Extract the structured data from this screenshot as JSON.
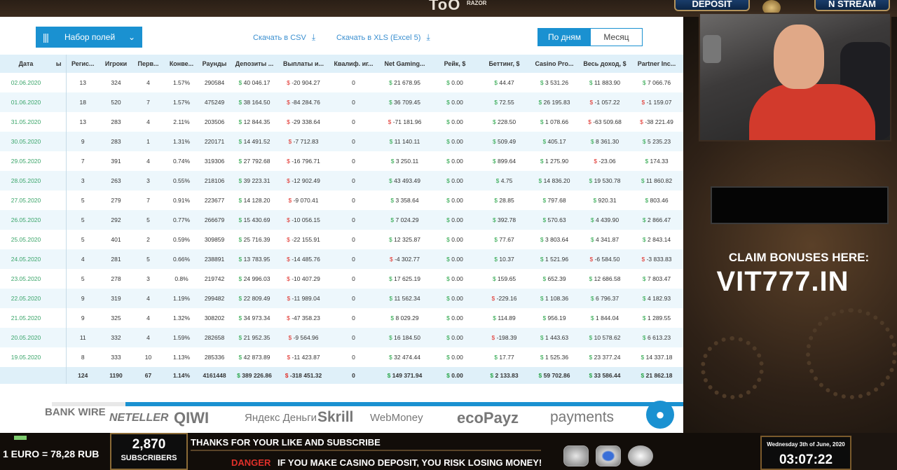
{
  "stream": {
    "logo": "ToO",
    "logo_sub": "RAZOR",
    "deposit_label": "DEPOSIT",
    "stream_label": "N STREAM",
    "claim_text": "CLAIM BONUSES HERE:",
    "claim_url": "VIT777.IN",
    "date_text": "Wednesday 3th of June, 2020",
    "time_text": "03:07:22",
    "euro_rate": "1 EURO = 78,28 RUB",
    "subscribers_count": "2,870",
    "subscribers_label": "SUBSCRIBERS",
    "ticker_top": "THANKS FOR YOUR LIKE AND SUBSCRIBE",
    "danger_label": "DANGER",
    "ticker_bottom": "IF YOU MAKE CASINO DEPOSIT, YOU RISK LOSING MONEY!"
  },
  "toolbar": {
    "fields_label": "Набор полей",
    "csv_label": "Скачать в CSV",
    "xls_label": "Скачать в XLS (Excel 5)",
    "by_days": "По дням",
    "month": "Месяц"
  },
  "table": {
    "headers": [
      "Дата",
      "ы",
      "Регис...",
      "Игроки",
      "Перв...",
      "Конве...",
      "Раунды",
      "Депозиты ...",
      "Выплаты и...",
      "Квалиф. иг...",
      "Net Gaming...",
      "Рейк, $",
      "Беттинг, $",
      "Casino Pro...",
      "Весь доход, $",
      "Partner Inc..."
    ],
    "rows": [
      [
        "02.06.2020",
        "",
        "13",
        "324",
        "4",
        "1.57%",
        "290584",
        "40 046.17",
        "-20 904.27",
        "0",
        "21 678.95",
        "0.00",
        "44.47",
        "3 531.26",
        "11 883.90",
        "7 066.76"
      ],
      [
        "01.06.2020",
        "",
        "18",
        "520",
        "7",
        "1.57%",
        "475249",
        "38 164.50",
        "-84 284.76",
        "0",
        "36 709.45",
        "0.00",
        "72.55",
        "26 195.83",
        "-1 057.22",
        "-1 159.07"
      ],
      [
        "31.05.2020",
        "",
        "13",
        "283",
        "4",
        "2.11%",
        "203506",
        "12 844.35",
        "-29 338.64",
        "0",
        "-71 181.96",
        "0.00",
        "228.50",
        "1 078.66",
        "-63 509.68",
        "-38 221.49"
      ],
      [
        "30.05.2020",
        "",
        "9",
        "283",
        "1",
        "1.31%",
        "220171",
        "14 491.52",
        "-7 712.83",
        "0",
        "11 140.11",
        "0.00",
        "509.49",
        "405.17",
        "8 361.30",
        "5 235.23"
      ],
      [
        "29.05.2020",
        "",
        "7",
        "391",
        "4",
        "0.74%",
        "319306",
        "27 792.68",
        "-16 796.71",
        "0",
        "3 250.11",
        "0.00",
        "899.64",
        "1 275.90",
        "-23.06",
        "174.33"
      ],
      [
        "28.05.2020",
        "",
        "3",
        "263",
        "3",
        "0.55%",
        "218106",
        "39 223.31",
        "-12 902.49",
        "0",
        "43 493.49",
        "0.00",
        "4.75",
        "14 836.20",
        "19 530.78",
        "11 860.82"
      ],
      [
        "27.05.2020",
        "",
        "5",
        "279",
        "7",
        "0.91%",
        "223677",
        "14 128.20",
        "-9 070.41",
        "0",
        "3 358.64",
        "0.00",
        "28.85",
        "797.68",
        "920.31",
        "803.46"
      ],
      [
        "26.05.2020",
        "",
        "5",
        "292",
        "5",
        "0.77%",
        "266679",
        "15 430.69",
        "-10 056.15",
        "0",
        "7 024.29",
        "0.00",
        "392.78",
        "570.63",
        "4 439.90",
        "2 866.47"
      ],
      [
        "25.05.2020",
        "",
        "5",
        "401",
        "2",
        "0.59%",
        "309859",
        "25 716.39",
        "-22 155.91",
        "0",
        "12 325.87",
        "0.00",
        "77.67",
        "3 803.64",
        "4 341.87",
        "2 843.14"
      ],
      [
        "24.05.2020",
        "",
        "4",
        "281",
        "5",
        "0.66%",
        "238891",
        "13 783.95",
        "-14 485.76",
        "0",
        "-4 302.77",
        "0.00",
        "10.37",
        "1 521.96",
        "-6 584.50",
        "-3 833.83"
      ],
      [
        "23.05.2020",
        "",
        "5",
        "278",
        "3",
        "0.8%",
        "219742",
        "24 996.03",
        "-10 407.29",
        "0",
        "17 625.19",
        "0.00",
        "159.65",
        "652.39",
        "12 686.58",
        "7 803.47"
      ],
      [
        "22.05.2020",
        "",
        "9",
        "319",
        "4",
        "1.19%",
        "299482",
        "22 809.49",
        "-11 989.04",
        "0",
        "11 562.34",
        "0.00",
        "-229.16",
        "1 108.36",
        "6 796.37",
        "4 182.93"
      ],
      [
        "21.05.2020",
        "",
        "9",
        "325",
        "4",
        "1.32%",
        "308202",
        "34 973.34",
        "-47 358.23",
        "0",
        "8 029.29",
        "0.00",
        "114.89",
        "956.19",
        "1 844.04",
        "1 289.55"
      ],
      [
        "20.05.2020",
        "",
        "11",
        "332",
        "4",
        "1.59%",
        "282658",
        "21 952.35",
        "-9 564.96",
        "0",
        "16 184.50",
        "0.00",
        "-198.39",
        "1 443.63",
        "10 578.62",
        "6 613.23"
      ],
      [
        "19.05.2020",
        "",
        "8",
        "333",
        "10",
        "1.13%",
        "285336",
        "42 873.89",
        "-11 423.87",
        "0",
        "32 474.44",
        "0.00",
        "17.77",
        "1 525.36",
        "23 377.24",
        "14 337.18"
      ]
    ],
    "totals": [
      "",
      "",
      "124",
      "1190",
      "67",
      "1.14%",
      "4161448",
      "389 226.86",
      "-318 451.32",
      "0",
      "149 371.94",
      "0.00",
      "2 133.83",
      "59 702.86",
      "33 586.44",
      "21 862.18"
    ],
    "currency_symbol": "$"
  },
  "payments": [
    "BANK WIRE",
    "NETELLER",
    "QIWI",
    "Яндекс Деньги",
    "Skrill",
    "WebMoney",
    "ecoPayz",
    "payments"
  ],
  "colors": {
    "accent": "#1a91d1",
    "positive": "#2aa64a",
    "negative": "#e0302a",
    "date": "#3aa56a"
  }
}
